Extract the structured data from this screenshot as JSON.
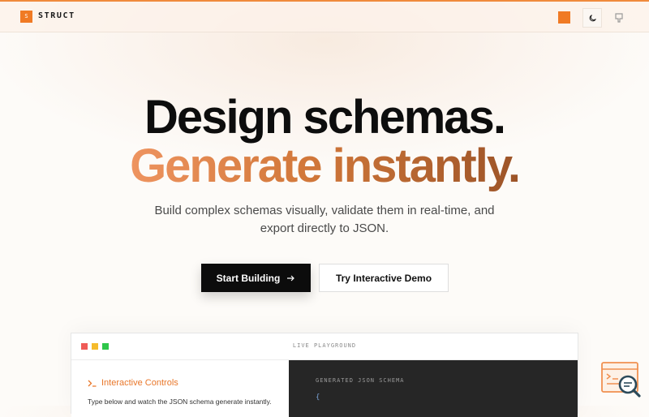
{
  "brand": {
    "logo_mark": "S",
    "name": "STRUCT"
  },
  "nav": {
    "accent_color": "#f07a24",
    "theme_toggle_icon": "moon-icon",
    "repo_icon": "github-icon"
  },
  "hero": {
    "line1": "Design schemas.",
    "line2": "Generate instantly.",
    "subtitle": "Build complex schemas visually, validate them in real-time, and export directly to JSON."
  },
  "cta": {
    "primary_label": "Start Building",
    "primary_icon": "arrow-right-icon",
    "secondary_label": "Try Interactive Demo"
  },
  "playground": {
    "title": "LIVE PLAYGROUND",
    "window_dots": [
      "#ef5b57",
      "#f5bb2c",
      "#2ec64a"
    ],
    "controls_title": "Interactive Controls",
    "controls_icon": "terminal-icon",
    "controls_description": "Type below and watch the JSON schema generate instantly.",
    "output_label": "GENERATED JSON SCHEMA",
    "output_first_line": "{"
  },
  "help_widget": {
    "icon": "search-help-icon"
  }
}
